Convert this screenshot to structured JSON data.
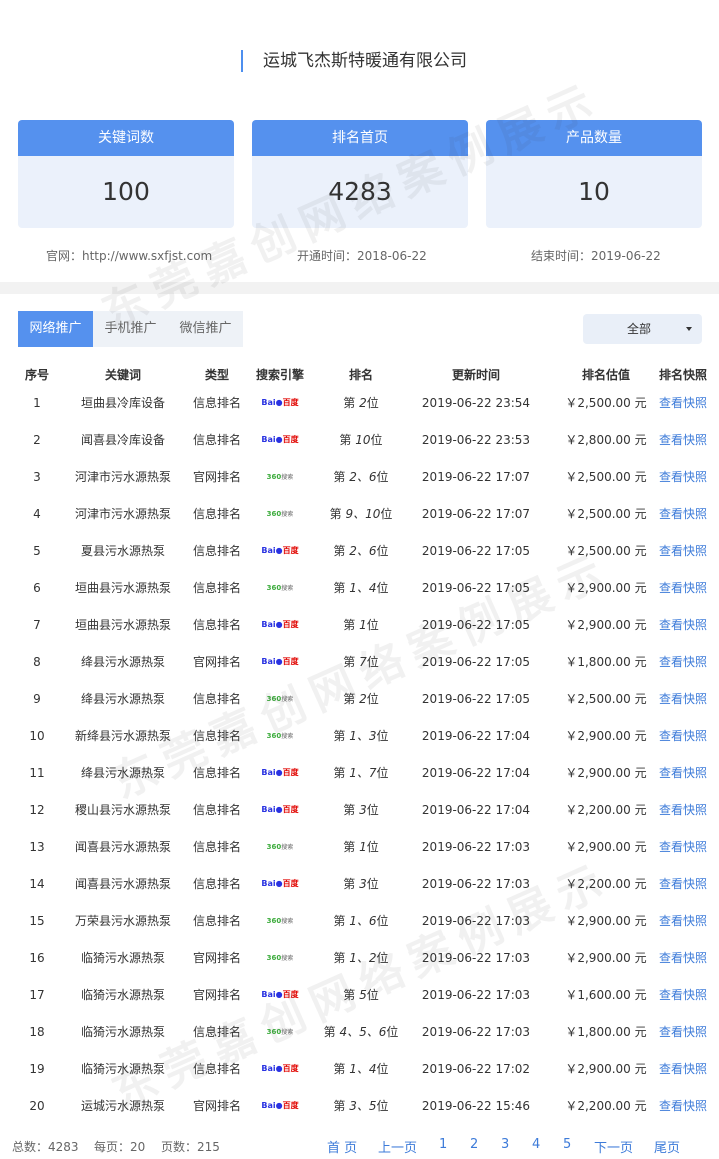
{
  "company": "运城飞杰斯特暖通有限公司",
  "cards": [
    {
      "title": "关键词数",
      "value": "100"
    },
    {
      "title": "排名首页",
      "value": "4283"
    },
    {
      "title": "产品数量",
      "value": "10"
    }
  ],
  "info": {
    "site": "官网：http://www.sxfjst.com",
    "start": "开通时间：2018-06-22",
    "end": "结束时间：2019-06-22"
  },
  "tabs": [
    "网络推广",
    "手机推广",
    "微信推广"
  ],
  "filter": {
    "selected": "全部"
  },
  "table": {
    "headers": [
      "序号",
      "关键词",
      "类型",
      "搜索引擎",
      "排名",
      "更新时间",
      "排名估值",
      "排名快照"
    ],
    "rows": [
      {
        "no": "1",
        "keyword": "垣曲县冷库设备",
        "type": "信息排名",
        "engine": "baidu",
        "rank": [
          "第",
          "2",
          "位"
        ],
        "time": "2019-06-22 23:54",
        "value": "￥2,500.00 元",
        "snap": "查看快照"
      },
      {
        "no": "2",
        "keyword": "闻喜县冷库设备",
        "type": "信息排名",
        "engine": "baidu",
        "rank": [
          "第",
          "10",
          "位"
        ],
        "time": "2019-06-22 23:53",
        "value": "￥2,800.00 元",
        "snap": "查看快照"
      },
      {
        "no": "3",
        "keyword": "河津市污水源热泵",
        "type": "官网排名",
        "engine": "360",
        "rank": [
          "第",
          "2、6",
          "位"
        ],
        "time": "2019-06-22 17:07",
        "value": "￥2,500.00 元",
        "snap": "查看快照"
      },
      {
        "no": "4",
        "keyword": "河津市污水源热泵",
        "type": "信息排名",
        "engine": "360",
        "rank": [
          "第",
          "9、10",
          "位"
        ],
        "time": "2019-06-22 17:07",
        "value": "￥2,500.00 元",
        "snap": "查看快照"
      },
      {
        "no": "5",
        "keyword": "夏县污水源热泵",
        "type": "信息排名",
        "engine": "baidu",
        "rank": [
          "第",
          "2、6",
          "位"
        ],
        "time": "2019-06-22 17:05",
        "value": "￥2,500.00 元",
        "snap": "查看快照"
      },
      {
        "no": "6",
        "keyword": "垣曲县污水源热泵",
        "type": "信息排名",
        "engine": "360",
        "rank": [
          "第",
          "1、4",
          "位"
        ],
        "time": "2019-06-22 17:05",
        "value": "￥2,900.00 元",
        "snap": "查看快照"
      },
      {
        "no": "7",
        "keyword": "垣曲县污水源热泵",
        "type": "信息排名",
        "engine": "baidu",
        "rank": [
          "第",
          "1",
          "位"
        ],
        "time": "2019-06-22 17:05",
        "value": "￥2,900.00 元",
        "snap": "查看快照"
      },
      {
        "no": "8",
        "keyword": "绛县污水源热泵",
        "type": "官网排名",
        "engine": "baidu",
        "rank": [
          "第",
          "7",
          "位"
        ],
        "time": "2019-06-22 17:05",
        "value": "￥1,800.00 元",
        "snap": "查看快照"
      },
      {
        "no": "9",
        "keyword": "绛县污水源热泵",
        "type": "信息排名",
        "engine": "360",
        "rank": [
          "第",
          "2",
          "位"
        ],
        "time": "2019-06-22 17:05",
        "value": "￥2,500.00 元",
        "snap": "查看快照"
      },
      {
        "no": "10",
        "keyword": "新绛县污水源热泵",
        "type": "信息排名",
        "engine": "360",
        "rank": [
          "第",
          "1、3",
          "位"
        ],
        "time": "2019-06-22 17:04",
        "value": "￥2,900.00 元",
        "snap": "查看快照"
      },
      {
        "no": "11",
        "keyword": "绛县污水源热泵",
        "type": "信息排名",
        "engine": "baidu",
        "rank": [
          "第",
          "1、7",
          "位"
        ],
        "time": "2019-06-22 17:04",
        "value": "￥2,900.00 元",
        "snap": "查看快照"
      },
      {
        "no": "12",
        "keyword": "稷山县污水源热泵",
        "type": "信息排名",
        "engine": "baidu",
        "rank": [
          "第",
          "3",
          "位"
        ],
        "time": "2019-06-22 17:04",
        "value": "￥2,200.00 元",
        "snap": "查看快照"
      },
      {
        "no": "13",
        "keyword": "闻喜县污水源热泵",
        "type": "信息排名",
        "engine": "360",
        "rank": [
          "第",
          "1",
          "位"
        ],
        "time": "2019-06-22 17:03",
        "value": "￥2,900.00 元",
        "snap": "查看快照"
      },
      {
        "no": "14",
        "keyword": "闻喜县污水源热泵",
        "type": "信息排名",
        "engine": "baidu",
        "rank": [
          "第",
          "3",
          "位"
        ],
        "time": "2019-06-22 17:03",
        "value": "￥2,200.00 元",
        "snap": "查看快照"
      },
      {
        "no": "15",
        "keyword": "万荣县污水源热泵",
        "type": "信息排名",
        "engine": "360",
        "rank": [
          "第",
          "1、6",
          "位"
        ],
        "time": "2019-06-22 17:03",
        "value": "￥2,900.00 元",
        "snap": "查看快照"
      },
      {
        "no": "16",
        "keyword": "临猗污水源热泵",
        "type": "官网排名",
        "engine": "360",
        "rank": [
          "第",
          "1、2",
          "位"
        ],
        "time": "2019-06-22 17:03",
        "value": "￥2,900.00 元",
        "snap": "查看快照"
      },
      {
        "no": "17",
        "keyword": "临猗污水源热泵",
        "type": "官网排名",
        "engine": "baidu",
        "rank": [
          "第",
          "5",
          "位"
        ],
        "time": "2019-06-22 17:03",
        "value": "￥1,600.00 元",
        "snap": "查看快照"
      },
      {
        "no": "18",
        "keyword": "临猗污水源热泵",
        "type": "信息排名",
        "engine": "360",
        "rank": [
          "第",
          "4、5、6",
          "位"
        ],
        "time": "2019-06-22 17:03",
        "value": "￥1,800.00 元",
        "snap": "查看快照"
      },
      {
        "no": "19",
        "keyword": "临猗污水源热泵",
        "type": "信息排名",
        "engine": "baidu",
        "rank": [
          "第",
          "1、4",
          "位"
        ],
        "time": "2019-06-22 17:02",
        "value": "￥2,900.00 元",
        "snap": "查看快照"
      },
      {
        "no": "20",
        "keyword": "运城污水源热泵",
        "type": "官网排名",
        "engine": "baidu",
        "rank": [
          "第",
          "3、5",
          "位"
        ],
        "time": "2019-06-22 15:46",
        "value": "￥2,200.00 元",
        "snap": "查看快照"
      }
    ]
  },
  "engines": {
    "baidu": {
      "icon": "baidu-logo-icon",
      "text_a": "Bai",
      "text_b": "百度",
      "color_a": "#2932e1",
      "color_b": "#e10602"
    },
    "360": {
      "icon": "360-search-logo-icon",
      "text_a": "360",
      "text_b": "搜索",
      "color_a": "#3dac3d"
    }
  },
  "footer": {
    "total": "总数：4283",
    "per_page": "每页：20",
    "pages": "页数：215",
    "pager": [
      "首 页",
      "上一页",
      "1",
      "2",
      "3",
      "4",
      "5",
      "下一页",
      "尾页"
    ]
  },
  "watermark": "东莞嘉创网络案例展示",
  "colors": {
    "accent": "#5591ee",
    "link": "#3d7bd9",
    "card_bg": "#ebf1fb"
  }
}
